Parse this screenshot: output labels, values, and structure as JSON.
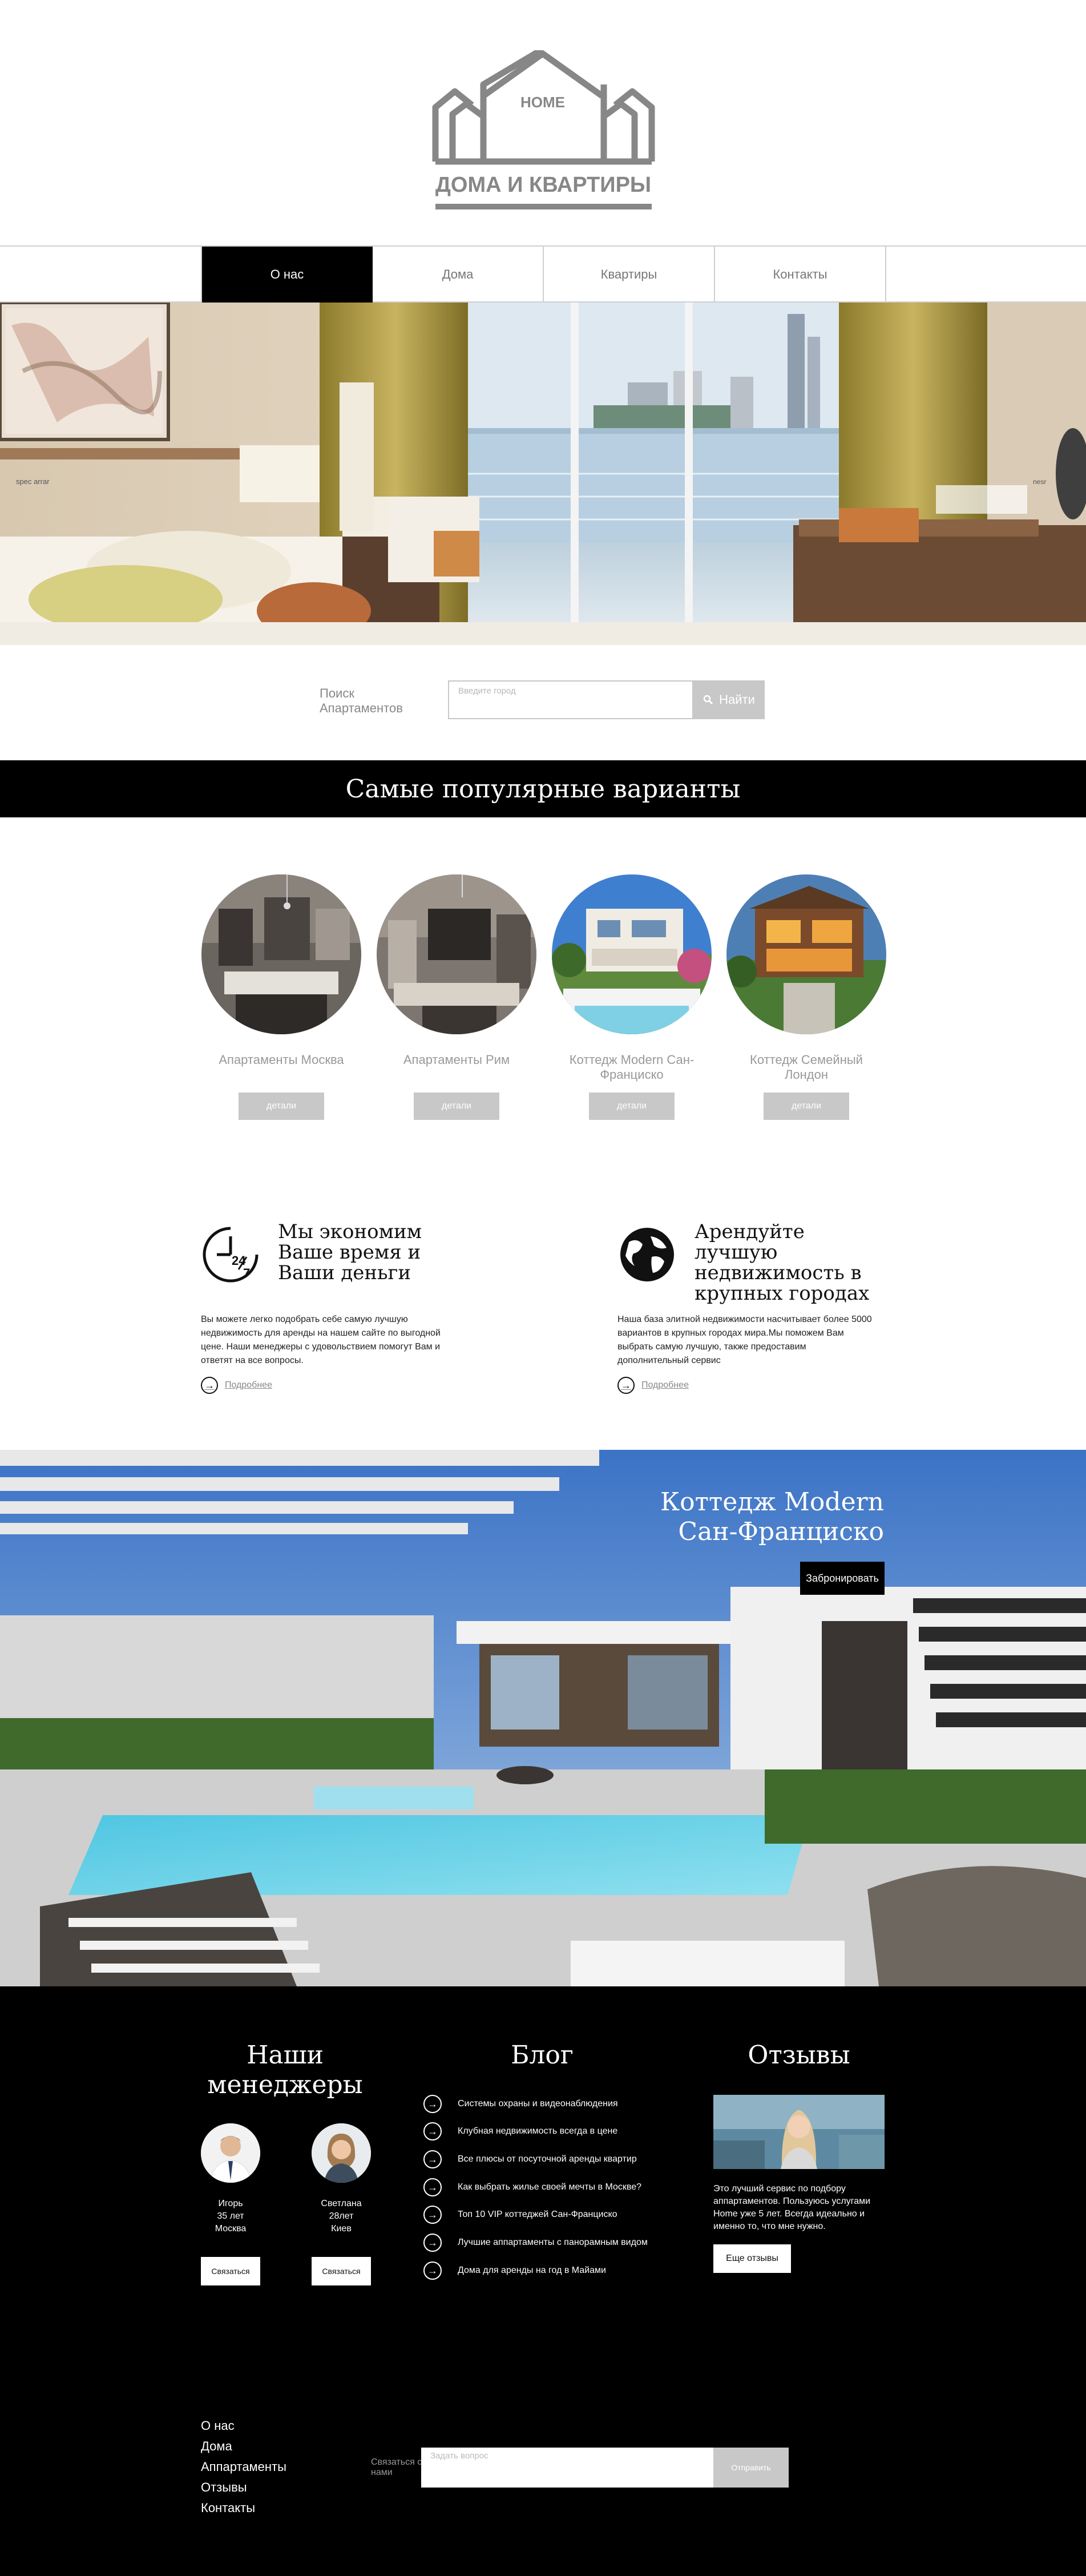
{
  "logo": {
    "top_text": "HOME",
    "bottom_text": "ДОМА И КВАРТИРЫ",
    "color": "#878787"
  },
  "nav": {
    "items": [
      {
        "label": "О нас",
        "active": true
      },
      {
        "label": "Дома",
        "active": false
      },
      {
        "label": "Квартиры",
        "active": false
      },
      {
        "label": "Контакты",
        "active": false
      }
    ]
  },
  "search": {
    "label": "Поиск Апартаментов",
    "placeholder": "Введите город",
    "button": "Найти"
  },
  "popular": {
    "title": "Самые популярные варианты",
    "cards": [
      {
        "title": "Апартаменты Москва",
        "button": "детали"
      },
      {
        "title": "Апартаменты Рим",
        "button": "детали"
      },
      {
        "title": "Коттедж Modern Сан-Франциско",
        "button": "детали"
      },
      {
        "title": "Коттедж Семейный Лондон",
        "button": "детали"
      }
    ]
  },
  "features": [
    {
      "icon": "24-7-clock-icon",
      "title": "Мы экономим Ваше время и Ваши деньги",
      "text": "Вы можете легко подобрать себе самую лучшую недвижимость для аренды на нашем сайте по выгодной цене. Наши менеджеры с удовольствием помогут Вам и ответят на все вопросы.",
      "more": "Подробнее"
    },
    {
      "icon": "globe-icon",
      "title": "Арендуйте лучшую недвижимость в крупных городах",
      "text": "Наша база элитной недвижимости насчитывает более 5000 вариантов в крупных городах мира.Мы поможем Вам выбрать самую лучшую, также предоставим дополнительный сервис",
      "more": "Подробнее"
    }
  ],
  "promo": {
    "title_line1": "Коттедж Modern",
    "title_line2": "Сан-Франциско",
    "button": "Забронировать"
  },
  "managers": {
    "title": "Наши менеджеры",
    "people": [
      {
        "name": "Игорь",
        "age": "35 лет",
        "city": "Москва",
        "button": "Связаться"
      },
      {
        "name": "Светлана",
        "age": "28лет",
        "city": "Киев",
        "button": "Связаться"
      }
    ]
  },
  "blog": {
    "title": "Блог",
    "items": [
      "Системы охраны и видеонаблюдения",
      "Клубная недвижимость всегда в цене",
      "Все плюсы от посуточной аренды квартир",
      "Как выбрать жилье своей мечты в Москве?",
      "Топ 10 VIP коттеджей Сан-Франциско",
      "Лучшие аппартаменты с панорамным видом",
      "Дома для аренды на год в Майами"
    ]
  },
  "reviews": {
    "title": "Отзывы",
    "text": "Это лучший сервис по подбору аппартаментов. Пользуюсь услугами Home уже 5 лет. Всегда идеально и именно то, что мне нужно.",
    "button": "Еще отзывы"
  },
  "footer": {
    "links": [
      "О нас",
      "Дома",
      "Аппартаменты",
      "Отзывы",
      "Контакты"
    ],
    "contact_label": "Связаться с нами",
    "placeholder": "Задать вопрос",
    "button": "Отправить"
  },
  "colors": {
    "accent_dark": "#000000",
    "muted_gray": "#c8c8c8",
    "text_gray": "#999999"
  }
}
